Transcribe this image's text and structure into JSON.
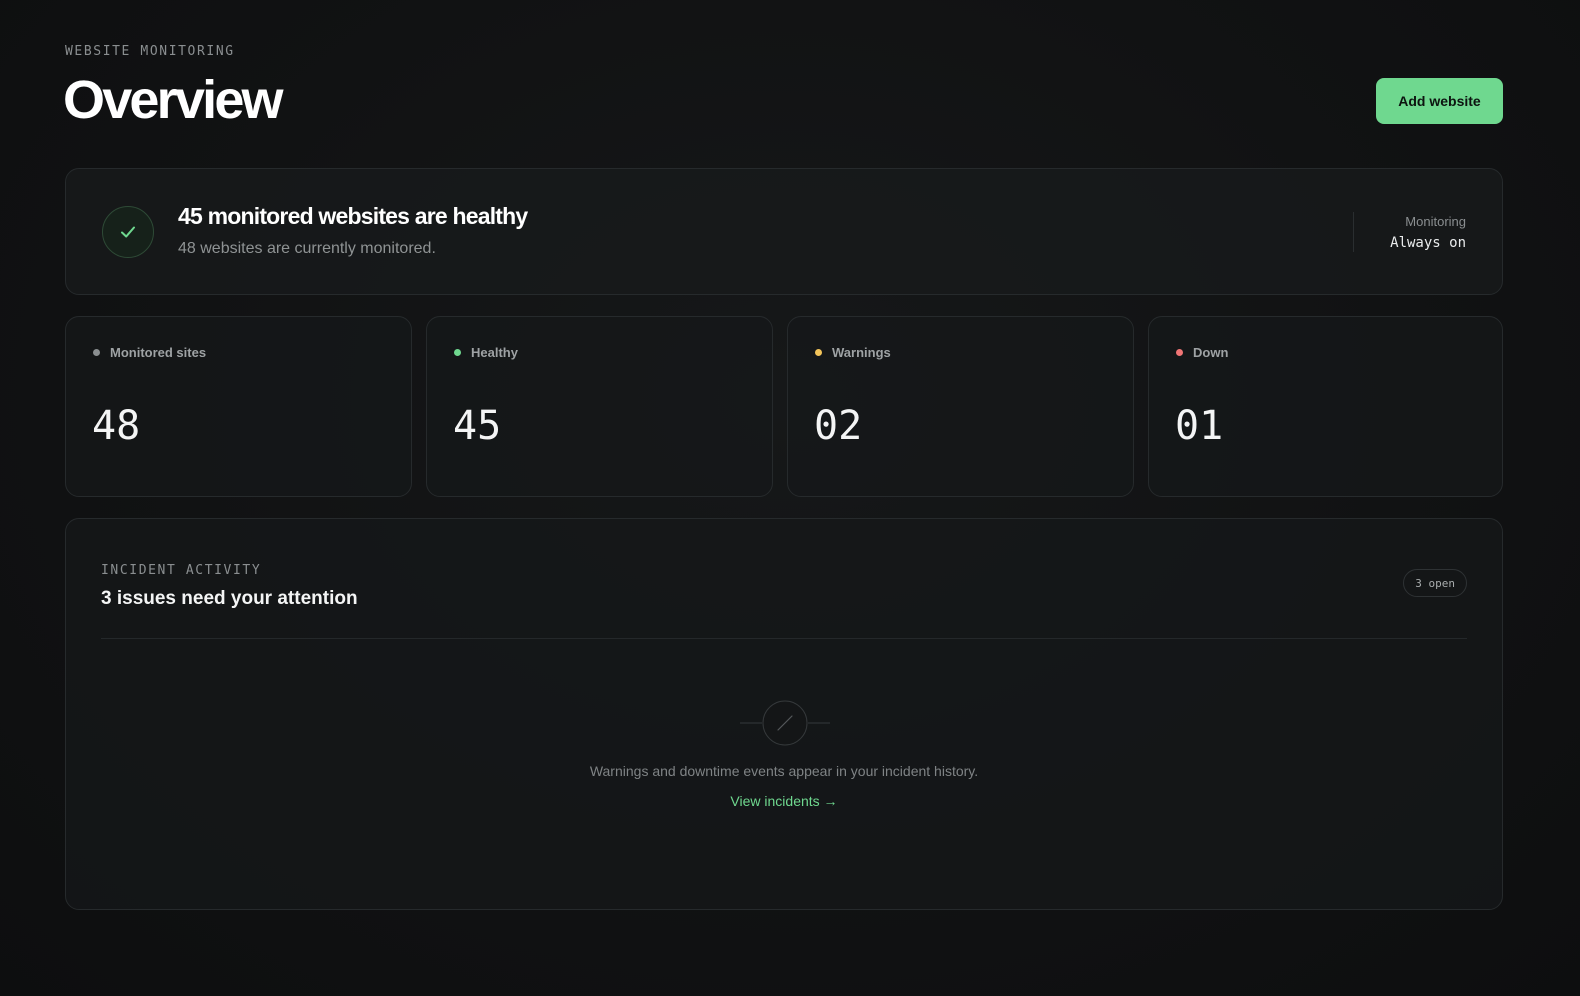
{
  "header": {
    "eyebrow": "WEBSITE MONITORING",
    "title": "Overview",
    "add_button_label": "Add website"
  },
  "status_banner": {
    "icon": "check-icon",
    "title": "45 monitored websites are healthy",
    "subtitle": "48 websites are currently monitored.",
    "monitoring_label": "Monitoring",
    "monitoring_value": "Always on"
  },
  "stats": [
    {
      "label": "Monitored sites",
      "value": "48",
      "dot_color": "#8a8e90"
    },
    {
      "label": "Healthy",
      "value": "45",
      "dot_color": "#6fd88f"
    },
    {
      "label": "Warnings",
      "value": "02",
      "dot_color": "#f2c45a"
    },
    {
      "label": "Down",
      "value": "01",
      "dot_color": "#f07575"
    }
  ],
  "incidents": {
    "eyebrow": "INCIDENT ACTIVITY",
    "title": "3 issues need your attention",
    "badge": "3 open",
    "empty_icon": "no-incidents-icon",
    "empty_text": "Warnings and downtime events appear in your incident history.",
    "link_label": "View incidents →"
  },
  "colors": {
    "accent": "#6fd88f",
    "background": "#111213",
    "warning": "#f2c45a",
    "danger": "#f07575"
  }
}
